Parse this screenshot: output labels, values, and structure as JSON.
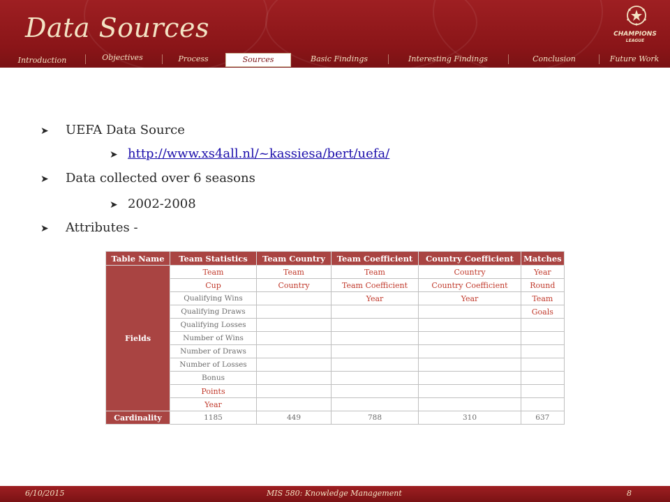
{
  "header": {
    "title": "Data Sources",
    "logo": {
      "line1": "CHAMPIONS",
      "line2": "LEAGUE",
      "icon": "starball-icon"
    }
  },
  "nav": [
    {
      "label": "Introduction",
      "active": false
    },
    {
      "label": "Objectives",
      "active": false
    },
    {
      "label": "Process",
      "active": false
    },
    {
      "label": "Sources",
      "active": true
    },
    {
      "label": "Basic Findings",
      "active": false
    },
    {
      "label": "Interesting Findings",
      "active": false
    },
    {
      "label": "Conclusion",
      "active": false
    },
    {
      "label": "Future Work",
      "active": false
    }
  ],
  "bullets": {
    "item1": "UEFA Data Source",
    "link": "http://www.xs4all.nl/~kassiesa/bert/uefa/",
    "item2": "Data collected over 6 seasons",
    "years": "2002-2008",
    "item3": "Attributes -",
    "bullet_icon": "arrow-bullet-icon"
  },
  "table": {
    "headers": [
      "Table Name",
      "Team Statistics",
      "Team Country",
      "Team Coefficient",
      "Country Coefficient",
      "Matches"
    ],
    "fields_label": "Fields",
    "cardinality_label": "Cardinality",
    "rows": [
      [
        "Team",
        "Team",
        "Team",
        "Country",
        "Year"
      ],
      [
        "Cup",
        "Country",
        "Team Coefficient",
        "Country Coefficient",
        "Round"
      ],
      [
        "Qualifying Wins",
        "",
        "Year",
        "Year",
        "Team"
      ],
      [
        "Qualifying Draws",
        "",
        "",
        "",
        "Goals"
      ],
      [
        "Qualifying Losses",
        "",
        "",
        "",
        ""
      ],
      [
        "Number of Wins",
        "",
        "",
        "",
        ""
      ],
      [
        "Number of Draws",
        "",
        "",
        "",
        ""
      ],
      [
        "Number of Losses",
        "",
        "",
        "",
        ""
      ],
      [
        "Bonus",
        "",
        "",
        "",
        ""
      ],
      [
        "Points",
        "",
        "",
        "",
        ""
      ],
      [
        "Year",
        "",
        "",
        "",
        ""
      ]
    ],
    "cardinality": [
      "1185",
      "449",
      "788",
      "310",
      "637"
    ]
  },
  "footer": {
    "date": "6/10/2015",
    "course": "MIS 580: Knowledge Management",
    "page": "8"
  },
  "colors": {
    "brand_red": "#8a1518",
    "header_cell": "#a94442",
    "accent_text": "#c0392b",
    "link": "#1a0dab"
  }
}
